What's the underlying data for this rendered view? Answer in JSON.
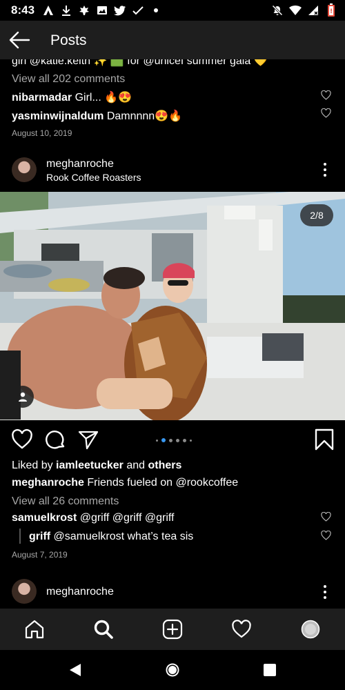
{
  "status": {
    "time": "8:43",
    "icons_left": [
      "a-logo-icon",
      "download-icon",
      "leaf-icon",
      "image-icon",
      "twitter-icon",
      "check-icon",
      "dot-icon"
    ],
    "icons_right": [
      "bell-off-icon",
      "wifi-icon",
      "signal-icon",
      "battery-icon"
    ]
  },
  "header": {
    "title": "Posts"
  },
  "prev_post": {
    "caption_fragment": "girl @katie.keith ✨ 🟩 for @unicef summer gala 💛",
    "view_comments": "View all 202 comments",
    "comments": [
      {
        "user": "nibarmadar",
        "text": "Girl... 🔥😍"
      },
      {
        "user": "yasminwijnaldum",
        "text": "Damnnnn😍🔥"
      }
    ],
    "date": "August 10, 2019"
  },
  "post": {
    "username": "meghanroche",
    "location": "Rook Coffee Roasters",
    "counter": "2/8",
    "liked_by_prefix": "Liked by ",
    "liked_by_user": "iamleetucker",
    "liked_by_and": " and ",
    "liked_by_others": "others",
    "caption_user": "meghanroche",
    "caption_text": " Friends fueled on @rookcoffee",
    "view_comments": "View all 26 comments",
    "comments": [
      {
        "user": "samuelkrost",
        "text": " @griff @griff @griff"
      },
      {
        "user": "griff",
        "text": " @samuelkrost what’s tea sis"
      }
    ],
    "date": "August 7, 2019"
  },
  "next_post": {
    "username": "meghanroche"
  },
  "bottom_nav": [
    "home-icon",
    "search-icon",
    "new-post-icon",
    "activity-icon",
    "profile-icon"
  ],
  "colors": {
    "background": "#000000",
    "bar": "#1e1e1e",
    "accent": "#3897f0",
    "muted": "#a8a8a8"
  }
}
